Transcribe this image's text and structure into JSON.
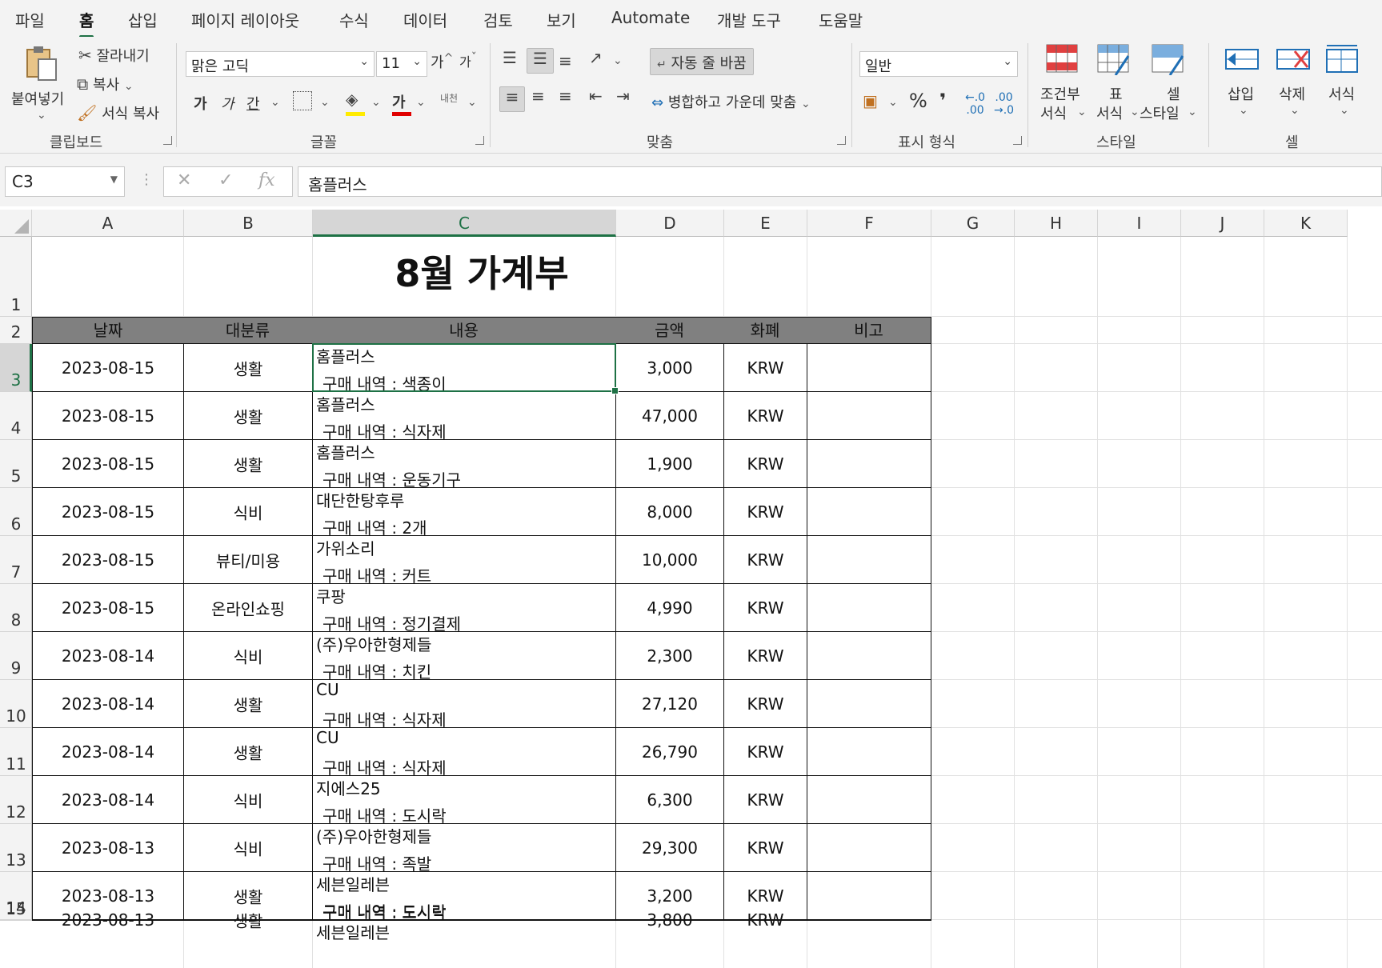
{
  "menu": {
    "tabs": [
      "파일",
      "홈",
      "삽입",
      "페이지 레이아웃",
      "수식",
      "데이터",
      "검토",
      "보기",
      "Automate",
      "개발 도구",
      "도움말"
    ],
    "active": "홈"
  },
  "ribbon": {
    "clipboard": {
      "paste": "붙여넣기",
      "cut": "잘라내기",
      "copy": "복사",
      "format_painter": "서식 복사",
      "group": "클립보드"
    },
    "font": {
      "name": "맑은 고딕",
      "size": "11",
      "increase": "가",
      "decrease": "가",
      "bold": "가",
      "italic": "가",
      "underline": "간",
      "font_color": "가",
      "phonetic": "내천",
      "group": "글꼴"
    },
    "alignment": {
      "wrap_text": "자동 줄 바꿈",
      "merge_center": "병합하고 가운데 맞춤",
      "group": "맞춤"
    },
    "number": {
      "format": "일반",
      "percent": "%",
      "comma": "❜",
      "group": "표시 형식"
    },
    "styles": {
      "conditional": [
        "조건부",
        "서식"
      ],
      "table": [
        "표",
        "서식"
      ],
      "cell_styles": [
        "셀",
        "스타일"
      ],
      "group": "스타일"
    },
    "cells": {
      "insert": "삽입",
      "delete": "삭제",
      "format": "서식",
      "group": "셀"
    }
  },
  "formula_bar": {
    "name_box": "C3",
    "formula": "홈플러스",
    "fx": "fx"
  },
  "columns": [
    "A",
    "B",
    "C",
    "D",
    "E",
    "F",
    "G",
    "H",
    "I",
    "J",
    "K"
  ],
  "selected_column": "C",
  "selected_row": "3",
  "sheet": {
    "title": "8월 가계부",
    "headers": [
      "날짜",
      "대분류",
      "내용",
      "금액",
      "화폐",
      "비고"
    ],
    "rows": [
      {
        "row": "3",
        "date": "2023-08-15",
        "category": "생활",
        "store": "홈플러스",
        "detail": "구매 내역 : 색종이",
        "amount": "3,000",
        "currency": "KRW",
        "note": ""
      },
      {
        "row": "4",
        "date": "2023-08-15",
        "category": "생활",
        "store": "홈플러스",
        "detail": "구매 내역 : 식자제",
        "amount": "47,000",
        "currency": "KRW",
        "note": ""
      },
      {
        "row": "5",
        "date": "2023-08-15",
        "category": "생활",
        "store": "홈플러스",
        "detail": "구매 내역 : 운동기구",
        "amount": "1,900",
        "currency": "KRW",
        "note": ""
      },
      {
        "row": "6",
        "date": "2023-08-15",
        "category": "식비",
        "store": "대단한탕후루",
        "detail": "구매 내역 :  2개",
        "amount": "8,000",
        "currency": "KRW",
        "note": ""
      },
      {
        "row": "7",
        "date": "2023-08-15",
        "category": "뷰티/미용",
        "store": "가위소리",
        "detail": "구매 내역 : 커트",
        "amount": "10,000",
        "currency": "KRW",
        "note": ""
      },
      {
        "row": "8",
        "date": "2023-08-15",
        "category": "온라인쇼핑",
        "store": "쿠팡",
        "detail": "구매 내역 : 정기결제",
        "amount": "4,990",
        "currency": "KRW",
        "note": ""
      },
      {
        "row": "9",
        "date": "2023-08-14",
        "category": "식비",
        "store": "(주)우아한형제들",
        "detail": "구매 내역 : 치킨",
        "amount": "2,300",
        "currency": "KRW",
        "note": ""
      },
      {
        "row": "10",
        "date": "2023-08-14",
        "category": "생활",
        "store": "CU",
        "detail": "구매 내역 : 식자제",
        "amount": "27,120",
        "currency": "KRW",
        "note": ""
      },
      {
        "row": "11",
        "date": "2023-08-14",
        "category": "생활",
        "store": "CU",
        "detail": "구매 내역 : 식자제",
        "amount": "26,790",
        "currency": "KRW",
        "note": ""
      },
      {
        "row": "12",
        "date": "2023-08-14",
        "category": "식비",
        "store": "지에스25",
        "detail": "구매 내역 : 도시락",
        "amount": "6,300",
        "currency": "KRW",
        "note": ""
      },
      {
        "row": "13",
        "date": "2023-08-13",
        "category": "식비",
        "store": "(주)우아한형제들",
        "detail": "구매 내역 : 족발",
        "amount": "29,300",
        "currency": "KRW",
        "note": ""
      },
      {
        "row": "14",
        "date": "2023-08-13",
        "category": "생활",
        "store": "세븐일레븐",
        "detail": "구매 내역 : 도시락",
        "amount": "3,200",
        "currency": "KRW",
        "note": ""
      },
      {
        "row": "15",
        "date": "2023-08-13",
        "category": "생활",
        "store": "세븐일레븐",
        "detail": "구매 내역 : 도시락",
        "amount": "3,800",
        "currency": "KRW",
        "note": ""
      }
    ]
  },
  "colors": {
    "accent": "#1e7145",
    "header_fill": "#808080",
    "font_highlight": "#ffeb00",
    "font_color": "#e00000"
  }
}
